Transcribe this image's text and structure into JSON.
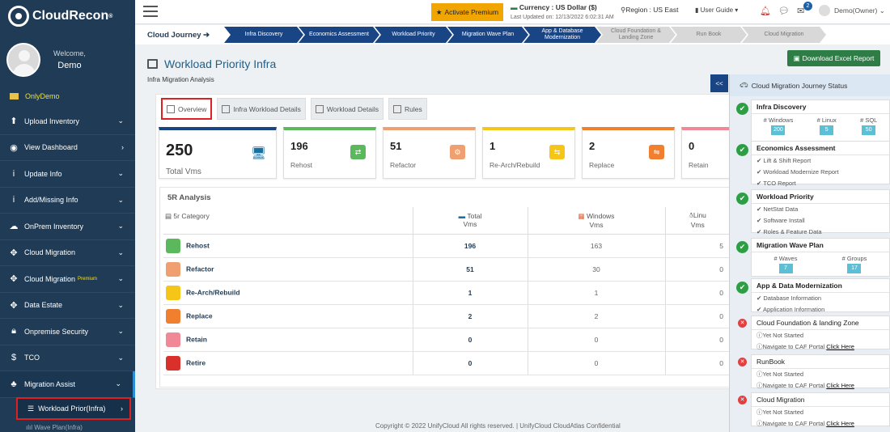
{
  "brand": {
    "name": "CloudRecon",
    "mark": "®"
  },
  "profile": {
    "welcome": "Welcome,",
    "name": "Demo"
  },
  "sidebar": {
    "folder": "OnlyDemo",
    "items": [
      {
        "label": "Upload Inventory",
        "icon": "upload-icon",
        "chevron": "⌄"
      },
      {
        "label": "View Dashboard",
        "icon": "dashboard-icon",
        "chevron": "›"
      },
      {
        "label": "Update Info",
        "icon": "info-icon",
        "chevron": "⌄"
      },
      {
        "label": "Add/Missing Info",
        "icon": "info-icon",
        "chevron": "⌄"
      },
      {
        "label": "OnPrem Inventory",
        "icon": "cloud-icon",
        "chevron": "⌄"
      },
      {
        "label": "Cloud Migration",
        "icon": "move-icon",
        "chevron": "⌄"
      },
      {
        "label": "Cloud Migration",
        "icon": "move-icon",
        "chevron": "⌄",
        "badge": "Premium"
      },
      {
        "label": "Data Estate",
        "icon": "move-icon",
        "chevron": "⌄"
      },
      {
        "label": "Onpremise Security",
        "icon": "lock-icon",
        "chevron": "⌄"
      },
      {
        "label": "TCO",
        "icon": "dollar-icon",
        "chevron": "⌄"
      },
      {
        "label": "Migration Assist",
        "icon": "migration-icon",
        "chevron": "⌄"
      }
    ],
    "active_sub": "Workload Prior(Infra)",
    "next_sub": "Wave Plan(Infra)"
  },
  "topbar": {
    "premium_button": "Activate Premium",
    "currency_label": "Currency : US Dollar ($)",
    "last_updated": "Last Updated on: 12/13/2022 6:02:31 AM",
    "region": "Region : US East",
    "user_guide": "User Guide ▾",
    "notification_count": "2",
    "user": "Demo(Owner) ⌄"
  },
  "journey": {
    "label": "Cloud Journey ➔",
    "steps": [
      {
        "label": "Infra Discovery",
        "state": "done"
      },
      {
        "label": "Economics Assessment",
        "state": "done"
      },
      {
        "label": "Workload Priority",
        "state": "done"
      },
      {
        "label": "Migration Wave Plan",
        "state": "done"
      },
      {
        "label": "App & Database Modernization",
        "state": "done"
      },
      {
        "label": "Cloud Foundation & Landing Zone",
        "state": "todo"
      },
      {
        "label": "Run Book",
        "state": "todo"
      },
      {
        "label": "Cloud Migration",
        "state": "todo"
      }
    ]
  },
  "page": {
    "title": "Workload Priority Infra",
    "subtitle": "Infra Migration Analysis",
    "excel_button": "Download Excel Report",
    "collapse_button": "<<"
  },
  "tabs": [
    "Overview",
    "Infra Workload Details",
    "Workload Details",
    "Rules"
  ],
  "stats": [
    {
      "value": "250",
      "label": "Total Vms",
      "color": "#1a4585"
    },
    {
      "value": "196",
      "label": "Rehost",
      "color": "#5cb85c"
    },
    {
      "value": "51",
      "label": "Refactor",
      "color": "#f0a070"
    },
    {
      "value": "1",
      "label": "Re-Arch/Rebuild",
      "color": "#f5c518"
    },
    {
      "value": "2",
      "label": "Replace",
      "color": "#f08030"
    },
    {
      "value": "0",
      "label": "Retain",
      "color": "#f08898"
    }
  ],
  "analysis": {
    "title": "5R Analysis",
    "headers": {
      "category": "5r Category",
      "total": "Total",
      "total_sub": "Vms",
      "windows": "Windows",
      "windows_sub": "Vms",
      "linux": "Linu",
      "linux_sub": "Vms"
    },
    "rows": [
      {
        "name": "Rehost",
        "total": "196",
        "windows": "163",
        "linux": "5",
        "color": "#5cb85c"
      },
      {
        "name": "Refactor",
        "total": "51",
        "windows": "30",
        "linux": "0",
        "color": "#f0a070"
      },
      {
        "name": "Re-Arch/Rebuild",
        "total": "1",
        "windows": "1",
        "linux": "0",
        "color": "#f5c518"
      },
      {
        "name": "Replace",
        "total": "2",
        "windows": "2",
        "linux": "0",
        "color": "#f08030"
      },
      {
        "name": "Retain",
        "total": "0",
        "windows": "0",
        "linux": "0",
        "color": "#f08898"
      },
      {
        "name": "Retire",
        "total": "0",
        "windows": "0",
        "linux": "0",
        "color": "#d9302c"
      }
    ]
  },
  "footer": "Copyright © 2022 UnifyCloud All rights reserved.   |  UnifyCloud CloudAtlas Confidential",
  "panel": {
    "title": "Cloud Migration Journey Status",
    "infra": {
      "title": "Infra Discovery",
      "labels": [
        "# Windows",
        "# Linux",
        "# SQL"
      ],
      "values": [
        "200",
        "5",
        "50"
      ]
    },
    "economics": {
      "title": "Economics Assessment",
      "items": [
        "Lift & Shift Report",
        "Workload Modernize Report",
        "TCO Report"
      ]
    },
    "workload": {
      "title": "Workload Priority",
      "items": [
        "NetStat Data",
        "Software Install",
        "Roles & Feature Data"
      ]
    },
    "wave": {
      "title": "Migration Wave Plan",
      "labels": [
        "# Waves",
        "# Groups"
      ],
      "values": [
        "7",
        "17"
      ]
    },
    "app": {
      "title": "App & Data Modernization",
      "items": [
        "Database Information",
        "Application Information"
      ]
    },
    "pending": [
      {
        "title": "Cloud Foundation & landing Zone",
        "status": "Yet Not Started",
        "nav": "Navigate to CAF Portal ",
        "link": "Click Here"
      },
      {
        "title": "RunBook",
        "status": "Yet Not Started",
        "nav": "Navigate to CAF Portal ",
        "link": "Click Here"
      },
      {
        "title": "Cloud Migration",
        "status": "Yet Not Started",
        "nav": "Navigate to CAF Portal ",
        "link": "Click Here"
      }
    ]
  }
}
